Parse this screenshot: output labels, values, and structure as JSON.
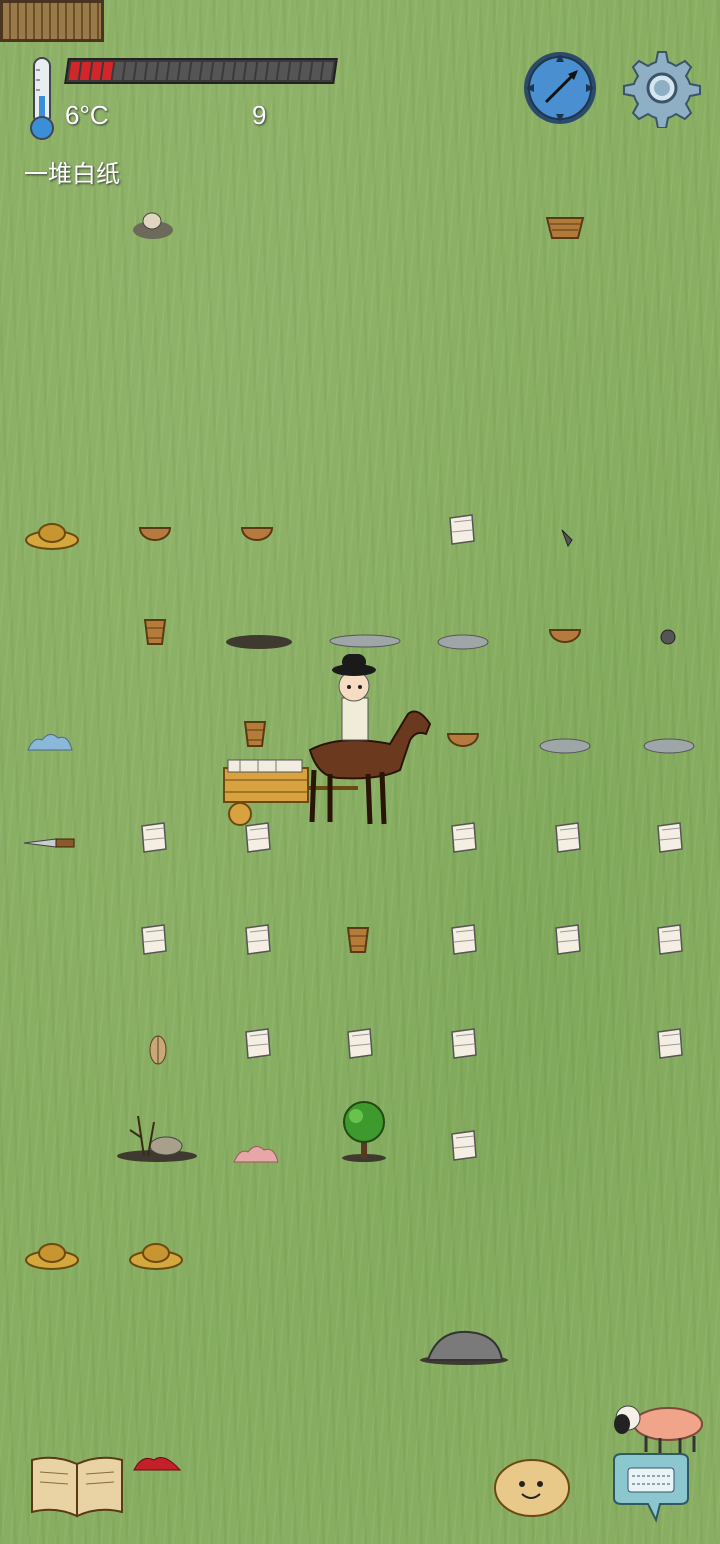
{
  "hud": {
    "temperature": "6°C",
    "food_count": "9",
    "held_item": "一堆白纸",
    "food_level": 0.17
  },
  "colors": {
    "grass": "#8aaf63",
    "food_full": "#d2262a",
    "food_empty": "#555555",
    "compass_face": "#4a8fd0",
    "gear": "#8fb0c4"
  },
  "icons": {
    "thermometer": "thermometer-icon",
    "compass": "compass-icon",
    "settings": "gear-icon",
    "journal": "book-icon",
    "emote": "face-icon",
    "chat": "keyboard-icon"
  }
}
